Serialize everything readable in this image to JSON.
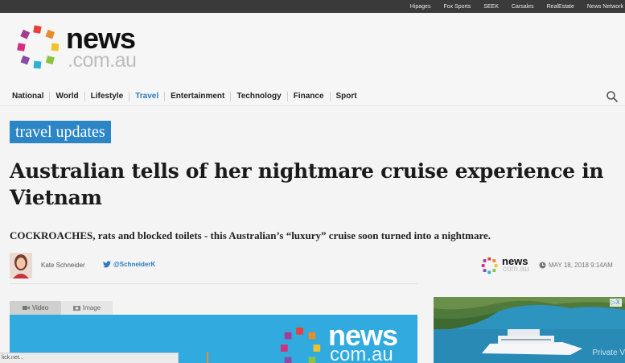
{
  "topbar": {
    "links": [
      "Hipages",
      "Fox Sports",
      "SEEK",
      "Carsales",
      "RealEstate",
      "News Network"
    ]
  },
  "brand": {
    "name": "news",
    "domain": ".com.au",
    "colors": [
      "#e8413a",
      "#e98b2a",
      "#f0c22c",
      "#8bc43f",
      "#2bb0d8",
      "#8a4aa5",
      "#d42f7a",
      "#a43d8f"
    ]
  },
  "nav": {
    "items": [
      "National",
      "World",
      "Lifestyle",
      "Travel",
      "Entertainment",
      "Technology",
      "Finance",
      "Sport"
    ],
    "active": "Travel",
    "search_icon": "search-icon"
  },
  "article": {
    "section_tag": "travel updates",
    "headline": "Australian tells of her nightmare cruise experience in Vietnam",
    "standfirst": "COCKROACHES, rats and blocked toilets - this Australian’s “luxury” cruise soon turned into a nightmare.",
    "author": "Kate Schneider",
    "twitter_handle": "@SchneiderK",
    "publisher_name": "news",
    "publisher_domain": "com.au",
    "date": "MAY 18, 2018 9:14AM"
  },
  "media": {
    "tabs": [
      "Video",
      "Image"
    ],
    "video_brand": "news",
    "video_domain": "com.au"
  },
  "ad": {
    "badge": "▷X",
    "caption": "Private V"
  },
  "status_bar": {
    "text": "lick.net..."
  },
  "colors": {
    "accent": "#2c86c6",
    "topbar": "#3a3a3a",
    "link": "#2a7bbf"
  }
}
